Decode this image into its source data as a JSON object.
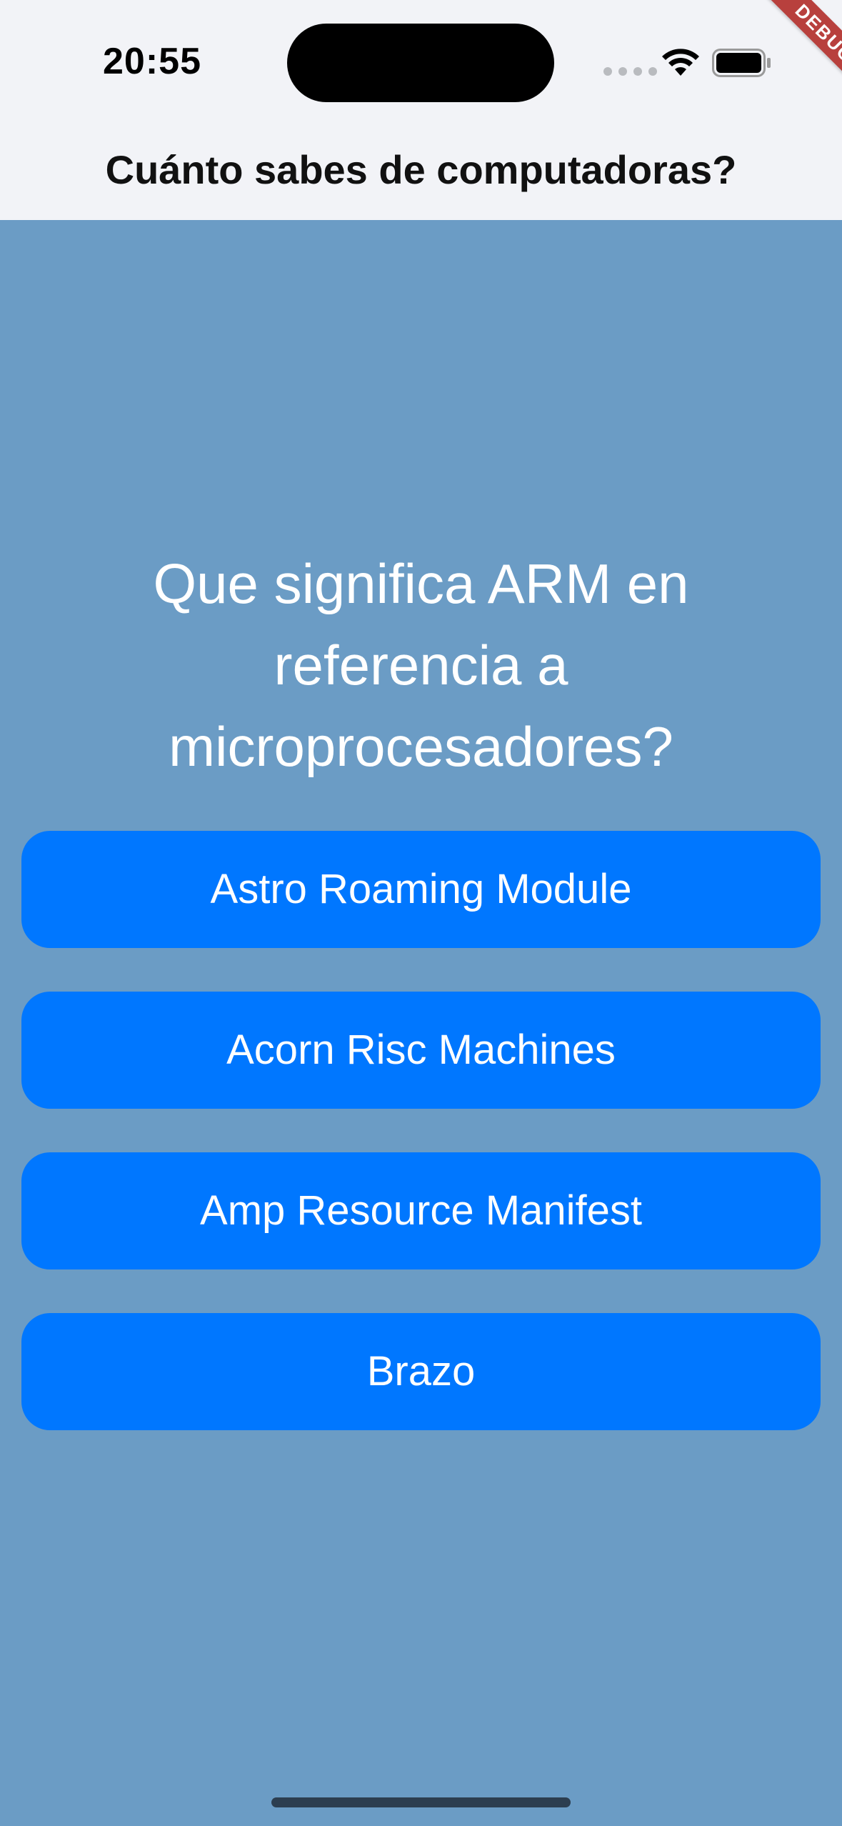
{
  "status_bar": {
    "time": "20:55"
  },
  "debug_banner": "DEBUG",
  "app_bar": {
    "title": "Cuánto sabes de computadoras?"
  },
  "question": {
    "text": "Que significa ARM en referencia a microprocesadores?"
  },
  "answers": [
    {
      "label": "Astro Roaming Module"
    },
    {
      "label": "Acorn Risc Machines"
    },
    {
      "label": "Amp Resource Manifest"
    },
    {
      "label": "Brazo"
    }
  ],
  "colors": {
    "background": "#6b9cc5",
    "app_bar": "#f2f3f7",
    "button": "#0077ff",
    "debug_ribbon": "#b8403d"
  },
  "icons": [
    "cellular-signal-icon",
    "wifi-icon",
    "battery-icon"
  ]
}
